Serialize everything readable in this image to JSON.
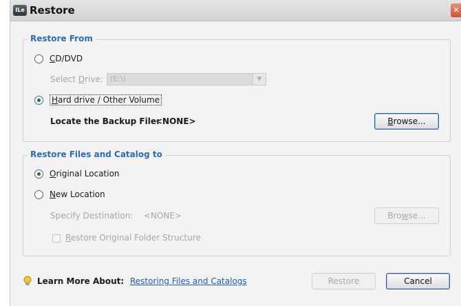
{
  "window": {
    "title": "Restore",
    "app_icon_text": "ILe",
    "close_glyph": "✕"
  },
  "restore_from": {
    "title": "Restore From",
    "cd_dvd": {
      "label_mnemonic": "C",
      "label_rest": "D/DVD",
      "checked": false
    },
    "select_drive": {
      "label_pre": "Select ",
      "label_mnemonic": "D",
      "label_post": "rive:",
      "value": "(E:\\)"
    },
    "hard_drive": {
      "label_mnemonic": "H",
      "label_rest": "ard drive / Other Volume",
      "checked": true
    },
    "locate_backup": {
      "label": "Locate the Backup File:",
      "value": "<NONE>"
    },
    "browse_button": {
      "label_mnemonic": "B",
      "label_rest": "rowse..."
    }
  },
  "restore_to": {
    "title": "Restore Files and Catalog to",
    "original_location": {
      "label_mnemonic": "O",
      "label_rest": "riginal Location",
      "checked": true
    },
    "new_location": {
      "label_mnemonic": "N",
      "label_rest": "ew Location",
      "checked": false
    },
    "specify_destination": {
      "label": "Specify Destination:",
      "value": "<NONE>"
    },
    "browse_button": {
      "label_pre": "Bro",
      "label_mnemonic": "w",
      "label_post": "se..."
    },
    "restore_structure": {
      "label_mnemonic": "R",
      "label_rest": "estore Original Folder Structure",
      "checked": false
    }
  },
  "footer": {
    "learn_more_label": "Learn More About:",
    "learn_more_link": "Restoring Files and Catalogs",
    "restore_button": "Restore",
    "cancel_button": "Cancel"
  },
  "icons": {
    "bulb": "lightbulb-icon",
    "dropdown": "chevron-down-icon",
    "close": "close-icon"
  },
  "colors": {
    "group_title": "#2c6bb5",
    "link": "#1f5bb8",
    "radio_dot": "#2d6c3c",
    "close_button": "#d2644a"
  }
}
